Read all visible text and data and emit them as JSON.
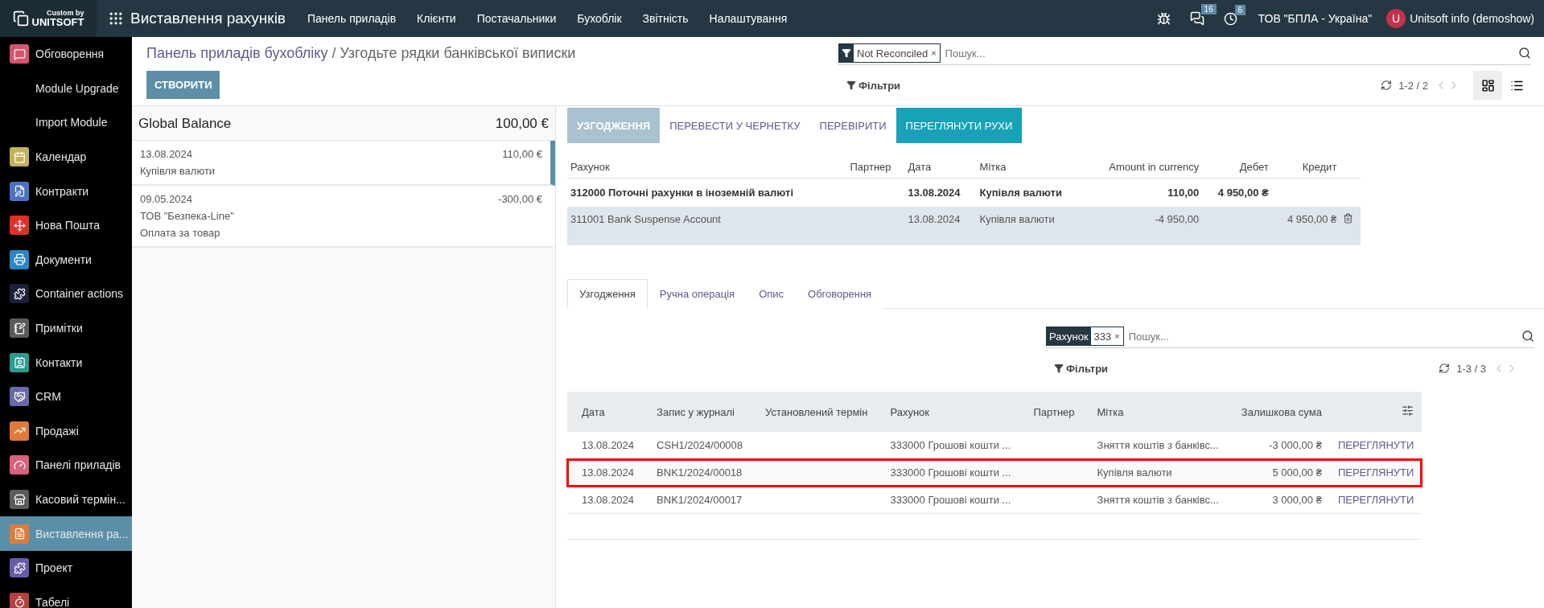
{
  "topbar": {
    "logo_caption": "Custom by",
    "logo_name": "UNITSOFT",
    "app_name": "Виставлення рахунків",
    "menu": [
      "Панель приладів",
      "Клієнти",
      "Постачальники",
      "Бухоблік",
      "Звітність",
      "Налаштування"
    ],
    "messages_count": "16",
    "activities_count": "6",
    "company": "ТОВ \"БПЛА - Україна\"",
    "avatar_letter": "U",
    "user": "Unitsoft info (demoshow)"
  },
  "sidebar": {
    "items": [
      {
        "label": "Обговорення",
        "color": "#d9536f",
        "selected": false
      },
      {
        "label": "Module Upgrade",
        "selected": false
      },
      {
        "label": "Import Module",
        "selected": false
      },
      {
        "label": "Календар",
        "color": "#c2b35a",
        "selected": false
      },
      {
        "label": "Контракти",
        "color": "#4a73c4",
        "selected": false
      },
      {
        "label": "Нова Пошта",
        "color": "#e0302a",
        "selected": false
      },
      {
        "label": "Документи",
        "color": "#2a86c4",
        "selected": false
      },
      {
        "label": "Container actions",
        "color": "#1c1f3a",
        "selected": false
      },
      {
        "label": "Примітки",
        "color": "#5b5b5b",
        "selected": false
      },
      {
        "label": "Контакти",
        "color": "#2a9d8f",
        "selected": false
      },
      {
        "label": "CRM",
        "color": "#6a6aa8",
        "selected": false
      },
      {
        "label": "Продажі",
        "color": "#e07a3a",
        "selected": false
      },
      {
        "label": "Панелі приладів",
        "color": "#d9607f",
        "selected": false
      },
      {
        "label": "Касовий термін...",
        "color": "#5b5b5b",
        "selected": false
      },
      {
        "label": "Виставлення ра...",
        "color": "#e07a3a",
        "selected": true
      },
      {
        "label": "Проект",
        "color": "#6a5aa8",
        "selected": false
      },
      {
        "label": "Табелі",
        "color": "#b4433f",
        "selected": false
      }
    ]
  },
  "control_panel": {
    "breadcrumb_parent": "Панель приладів бухобліку",
    "breadcrumb_separator": "/",
    "breadcrumb_current": "Узгодьте рядки банківської виписки",
    "search": {
      "facet": "Not Reconciled",
      "remove": "×",
      "placeholder": "Пошук..."
    },
    "create_button": "СТВОРИТИ",
    "filters": "Фільтри",
    "pager": "1-2 / 2",
    "view_buttons": [
      {
        "selected": true
      },
      {
        "selected": false
      }
    ]
  },
  "statement_lines": {
    "balance_label": "Global Balance",
    "balance": "100,00 €",
    "items": [
      {
        "date": "13.08.2024",
        "amount": "110,00 €",
        "lines": [
          "Купівля валюти"
        ],
        "selected": true
      },
      {
        "date": "09.05.2024",
        "amount": "-300,00 €",
        "lines": [
          "ТОВ \"Безпека-Line\"",
          "Оплата за товар"
        ],
        "selected": false
      }
    ]
  },
  "actions": [
    {
      "label": "УЗГОДЖЕННЯ",
      "kind": "disabled"
    },
    {
      "label": "ПЕРЕВЕСТИ У ЧЕРНЕТКУ",
      "kind": "link"
    },
    {
      "label": "ПЕРЕВІРИТИ",
      "kind": "link"
    },
    {
      "label": "ПЕРЕГЛЯНУТИ РУХИ",
      "kind": "primary"
    }
  ],
  "move_lines": {
    "columns": [
      "Рахунок",
      "Партнер",
      "Дата",
      "Мітка",
      "Amount in currency",
      "Дебет",
      "Кредит"
    ],
    "rows": [
      {
        "cells": [
          "312000 Поточні рахунки в іноземній валюті",
          "",
          "13.08.2024",
          "Купівля валюти",
          "110,00",
          "4 950,00 ₴",
          ""
        ],
        "kind": "counterpart",
        "deletable": false
      },
      {
        "cells": [
          "311001 Bank Suspense Account",
          "",
          "13.08.2024",
          "Купівля валюти",
          "-4 950,00",
          "",
          "4 950,00 ₴"
        ],
        "kind": "suspense",
        "deletable": true
      }
    ]
  },
  "tabs": [
    {
      "label": "Узгодження",
      "selected": true
    },
    {
      "label": "Ручна операція",
      "selected": false
    },
    {
      "label": "Опис",
      "selected": false
    },
    {
      "label": "Обговорення",
      "selected": false
    }
  ],
  "match_search": {
    "facet_field": "Рахунок",
    "facet_value": "333",
    "remove": "×",
    "placeholder": "Пошук...",
    "filters": "Фільтри",
    "pager": "1-3 / 3"
  },
  "match_table": {
    "columns": [
      "Дата",
      "Запис у журналі",
      "Установлений термін",
      "Рахунок",
      "Партнер",
      "Мітка",
      "Залишкова сума"
    ],
    "rows": [
      {
        "cells": [
          "13.08.2024",
          "CSH1/2024/00008",
          "",
          "333000 Грошові кошти ...",
          "",
          "Зняття коштів з банківс...",
          "-3 000,00 ₴"
        ],
        "action": "ПЕРЕГЛЯНУТИ",
        "highlighted": false
      },
      {
        "cells": [
          "13.08.2024",
          "BNK1/2024/00018",
          "",
          "333000 Грошові кошти ...",
          "",
          "Купівля валюти",
          "5 000,00 ₴"
        ],
        "action": "ПЕРЕГЛЯНУТИ",
        "highlighted": true
      },
      {
        "cells": [
          "13.08.2024",
          "BNK1/2024/00017",
          "",
          "333000 Грошові кошти ...",
          "",
          "Зняття коштів з банківс...",
          "3 000,00 ₴"
        ],
        "action": "ПЕРЕГЛЯНУТИ",
        "highlighted": false
      }
    ]
  }
}
